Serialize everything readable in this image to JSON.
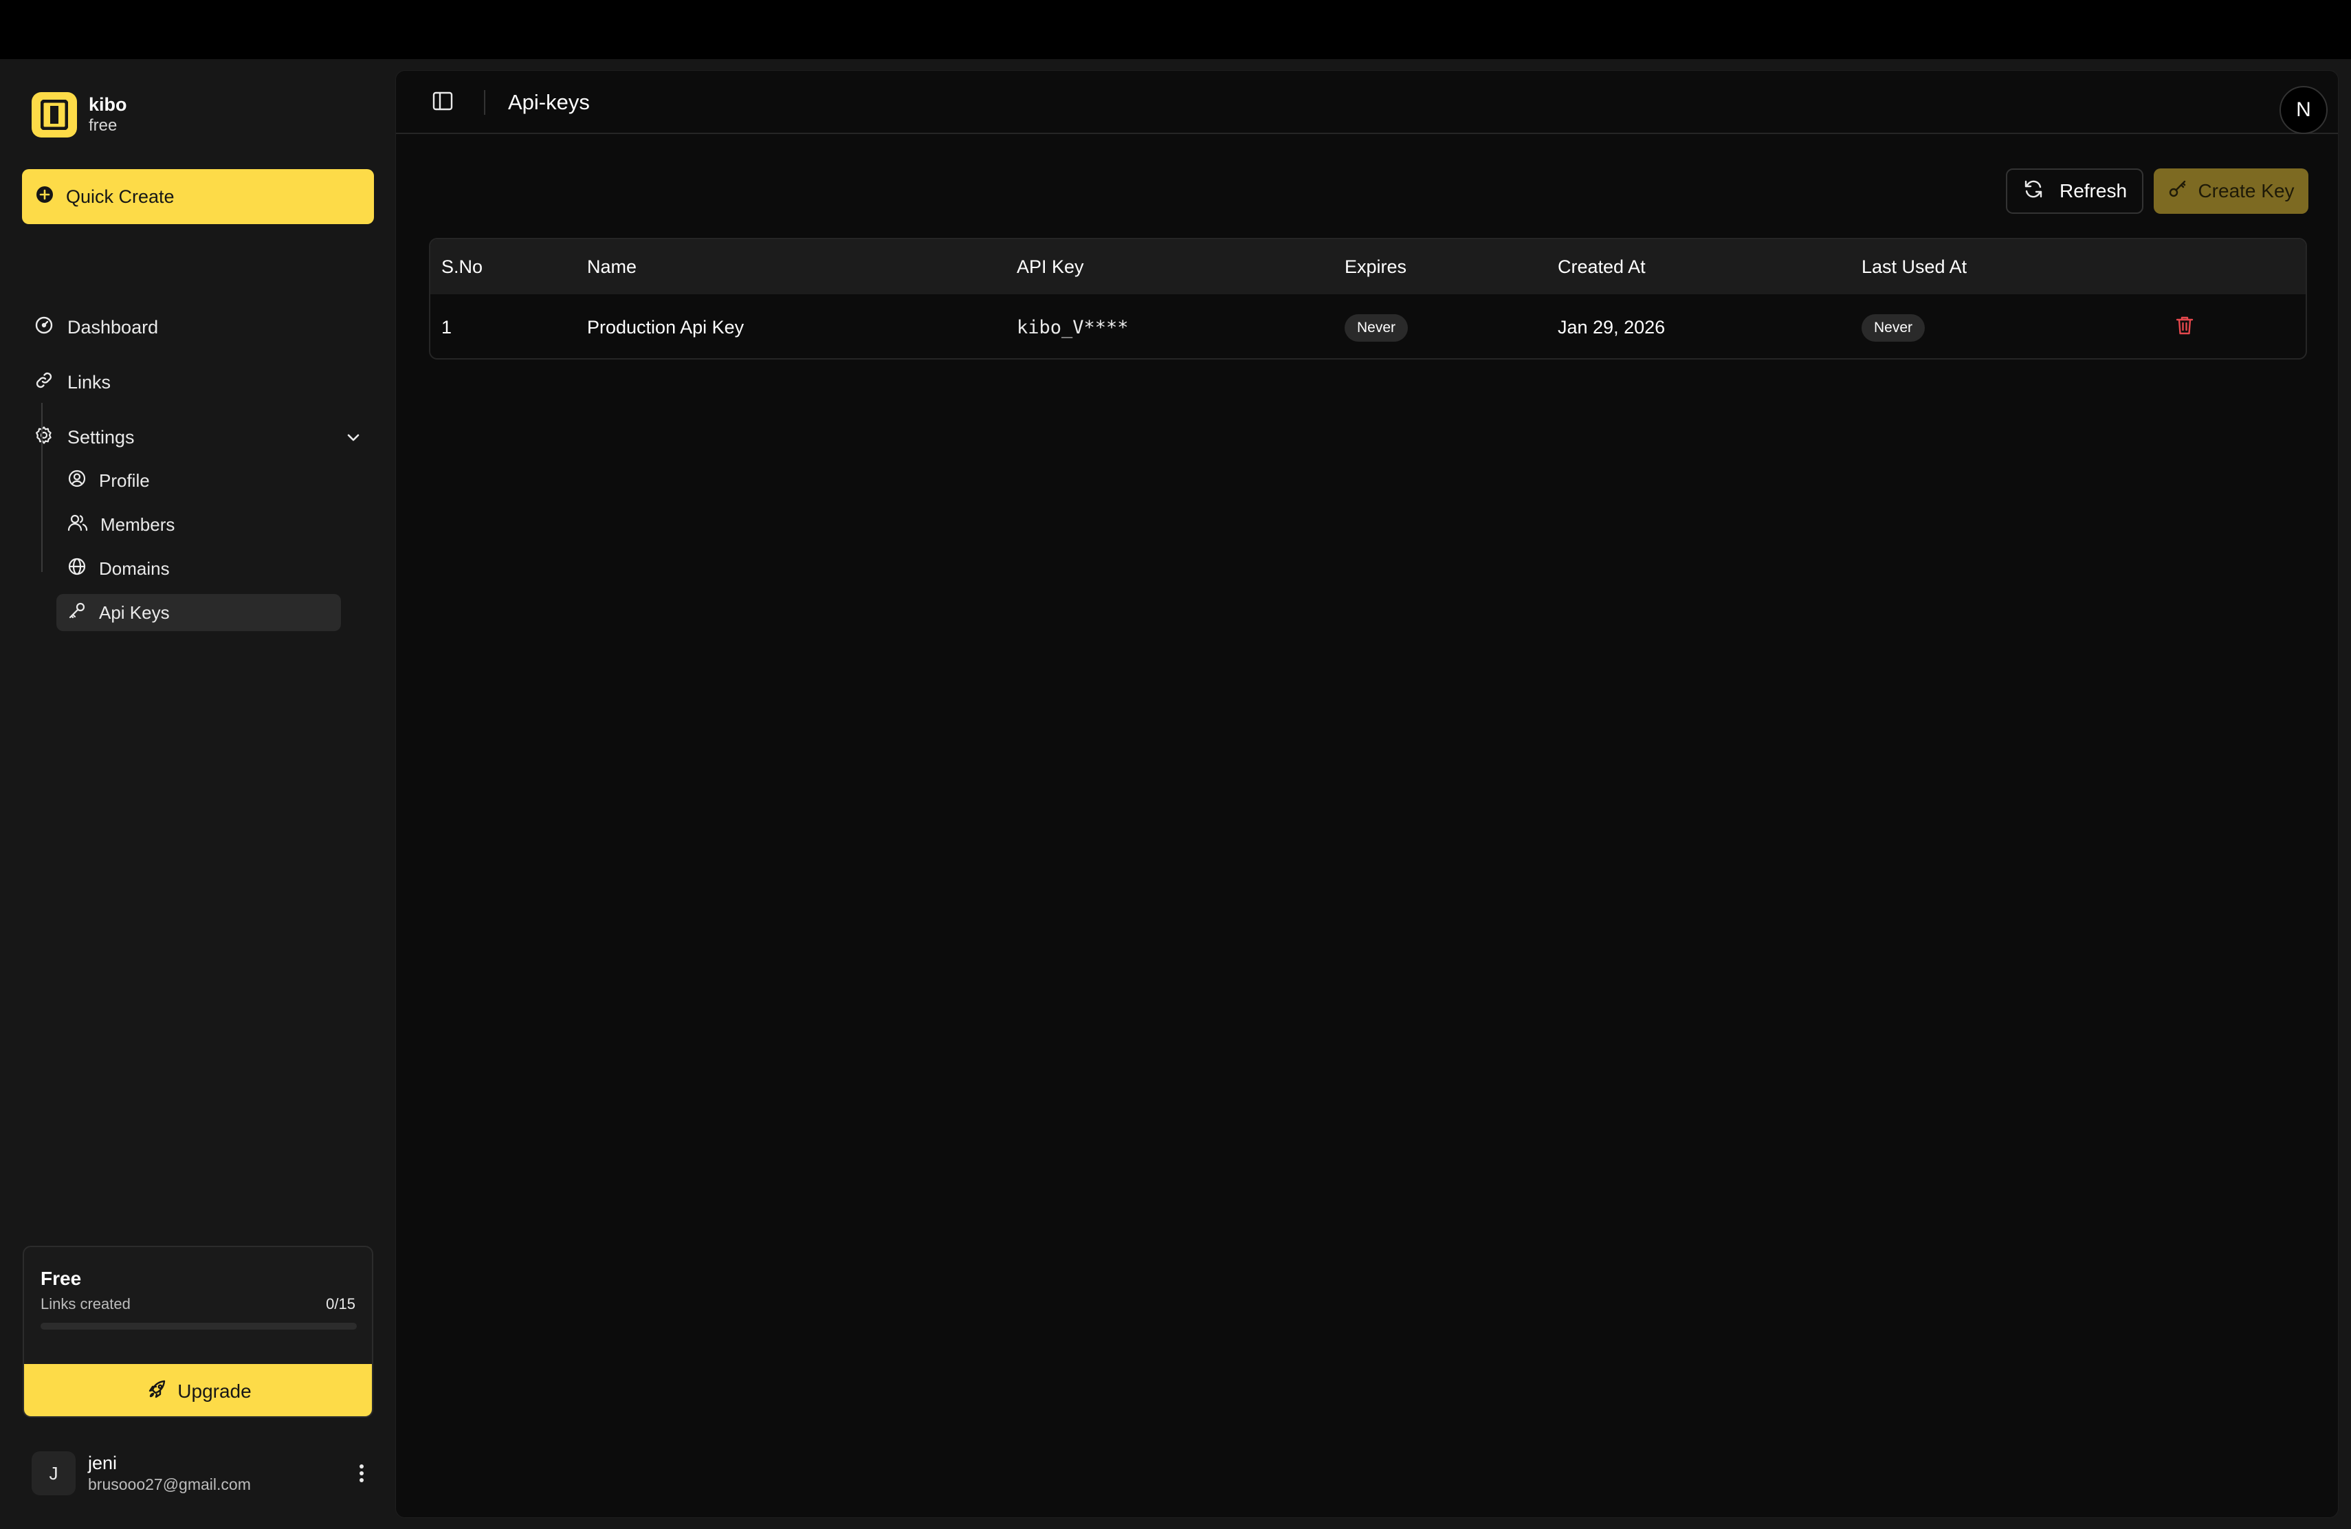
{
  "brand": {
    "name": "kibo",
    "plan": "free"
  },
  "sidebar": {
    "quick_create": "Quick Create",
    "items": [
      {
        "label": "Dashboard",
        "icon": "dashboard-icon"
      },
      {
        "label": "Links",
        "icon": "link-icon"
      },
      {
        "label": "Settings",
        "icon": "gear-icon",
        "expanded": true
      }
    ],
    "settings_items": [
      {
        "label": "Profile",
        "icon": "user-circle-icon"
      },
      {
        "label": "Members",
        "icon": "users-icon"
      },
      {
        "label": "Domains",
        "icon": "globe-icon"
      },
      {
        "label": "Api Keys",
        "icon": "key-icon",
        "active": true
      }
    ],
    "plan": {
      "title": "Free",
      "subtitle": "Links created",
      "count": "0/15",
      "progress": 0,
      "upgrade_label": "Upgrade"
    },
    "user": {
      "initial": "J",
      "name": "jeni",
      "email": "brusooo27@gmail.com"
    }
  },
  "header": {
    "title": "Api-keys",
    "avatar_letter": "N"
  },
  "toolbar": {
    "refresh_label": "Refresh",
    "create_label": "Create Key"
  },
  "table": {
    "columns": [
      "S.No",
      "Name",
      "API Key",
      "Expires",
      "Created At",
      "Last Used At"
    ],
    "rows": [
      {
        "sno": "1",
        "name": "Production Api Key",
        "api_key": "kibo_V****",
        "expires": "Never",
        "created_at": "Jan 29, 2026",
        "last_used_at": "Never"
      }
    ]
  },
  "colors": {
    "accent": "#fddb48",
    "create_button": "#7d6a22",
    "delete": "#e5484d",
    "background": "#0c0c0c",
    "sidebar": "#171717"
  }
}
